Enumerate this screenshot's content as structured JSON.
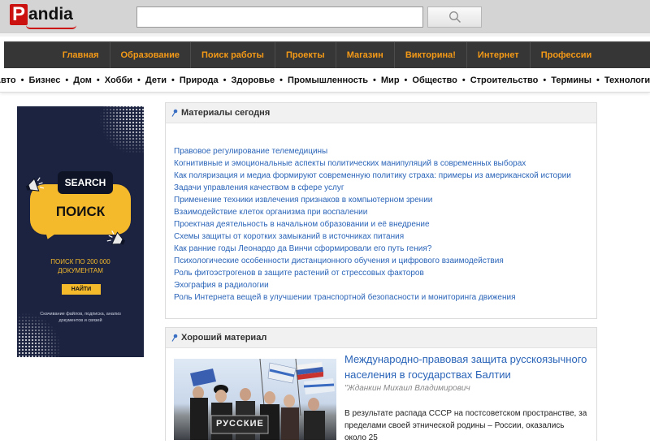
{
  "header": {
    "logo_initial": "P",
    "logo_rest": "andia",
    "search": {
      "value": "",
      "placeholder": ""
    },
    "search_button_icon": "search-icon"
  },
  "main_nav": [
    "Главная",
    "Образование",
    "Поиск работы",
    "Проекты",
    "Магазин",
    "Викторина!",
    "Интернет",
    "Профессии"
  ],
  "sub_nav": [
    "Авто",
    "Бизнес",
    "Дом",
    "Хобби",
    "Дети",
    "Природа",
    "Здоровье",
    "Промышленность",
    "Мир",
    "Общество",
    "Строительство",
    "Термины",
    "Технологии"
  ],
  "ad": {
    "bubble_top": "SEARCH",
    "bubble_main": "ПОИСК",
    "text_line1": "ПОИСК ПО 200 000",
    "text_line2": "ДОКУМЕНТАМ",
    "button": "НАЙТИ",
    "small_line1": "Скачивание файлов, подписка, анализ",
    "small_line2": "документов и связей"
  },
  "today": {
    "title": "Материалы сегодня",
    "links": [
      "Правовое регулирование телемедицины",
      "Когнитивные и эмоциональные аспекты политических манипуляций в современных выборах",
      "Как поляризация и медиа формируют современную политику страха: примеры из американской истории",
      "Задачи управления качеством в сфере услуг",
      "Применение техники извлечения признаков в компьютерном зрении",
      "Взаимодействие клеток организма при воспалении",
      "Проектная деятельность в начальном образовании и её внедрение",
      "Схемы защиты от коротких замыканий в источниках питания",
      "Как ранние годы Леонардо да Винчи сформировали его путь гения?",
      "Психологические особенности дистанционного обучения и цифрового взаимодействия",
      "Роль фитоэстрогенов в защите растений от стрессовых факторов",
      "Эхография в радиологии",
      "Роль Интернета вещей в улучшении транспортной безопасности и мониторинга движения"
    ]
  },
  "good": {
    "title": "Хороший материал",
    "article_title": "Международно-правовая защита русскоязычного населения в государствах Балтии",
    "author": "\"Жданкин Михаил Владимирович",
    "snippet": "В результате распада СССР на постсоветском пространстве, за пределами своей этнической родины – России, оказались около 25",
    "photo_sign": "РУССКИЕ"
  },
  "colors": {
    "nav_bg": "#363636",
    "nav_text": "#f59a17",
    "link": "#2a64b8",
    "logo_red": "#cc1111",
    "ad_bg": "#1b2340",
    "ad_yellow": "#f5b92c"
  }
}
